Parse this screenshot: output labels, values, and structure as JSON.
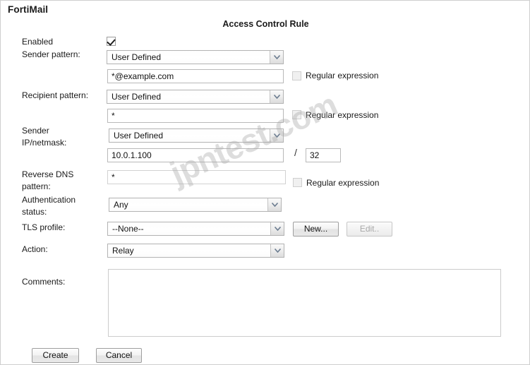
{
  "header": {
    "app_title": "FortiMail",
    "page_title": "Access Control Rule"
  },
  "watermark": {
    "text": "jpntest.com"
  },
  "form": {
    "enabled": {
      "label": "Enabled",
      "checked": true
    },
    "sender_pattern": {
      "label": "Sender pattern:",
      "select_value": "User Defined",
      "text_value": "*@example.com",
      "regex_label": "Regular expression",
      "regex_checked": false
    },
    "recipient_pattern": {
      "label": "Recipient pattern:",
      "select_value": "User Defined",
      "text_value": "*",
      "regex_label": "Regular expression",
      "regex_checked": false
    },
    "sender_ip_netmask": {
      "label": "Sender\nIP/netmask:",
      "select_value": "User Defined",
      "ip_value": "10.0.1.100",
      "separator": "/",
      "netmask_value": "32"
    },
    "reverse_dns_pattern": {
      "label": "Reverse DNS\npattern:",
      "text_value": "*",
      "regex_label": "Regular expression",
      "regex_checked": false
    },
    "authentication_status": {
      "label": "Authentication\nstatus:",
      "select_value": "Any"
    },
    "tls_profile": {
      "label": "TLS profile:",
      "select_value": "--None--",
      "new_button": "New...",
      "edit_button": "Edit..",
      "edit_disabled": true
    },
    "action": {
      "label": "Action:",
      "select_value": "Relay"
    },
    "comments": {
      "label": "Comments:",
      "text_value": ""
    }
  },
  "footer": {
    "create_button": "Create",
    "cancel_button": "Cancel"
  },
  "colors": {
    "background": "#ffffff",
    "text": "#1a1a1a",
    "field_border": "#b3b3b3",
    "watermark": "#aaaaaa"
  }
}
